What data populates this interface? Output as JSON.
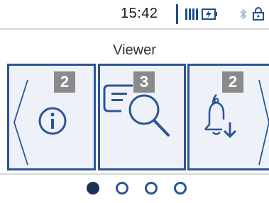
{
  "status_bar": {
    "time": "15:42",
    "icons": [
      "signal-bars-icon",
      "battery-charging-icon",
      "bluetooth-icon",
      "lock-icon"
    ]
  },
  "screen": {
    "title": "Viewer"
  },
  "carousel": {
    "panels": [
      {
        "badge": "2",
        "icon": "info-icon"
      },
      {
        "badge": "3",
        "icon": "document-search-icon"
      },
      {
        "badge": "2",
        "icon": "bell-download-icon"
      }
    ],
    "pager": {
      "total": 4,
      "active_index": 0
    }
  },
  "colors": {
    "accent": "#2c5596",
    "dark_accent": "#1c3158",
    "badge": "#8a8a8a",
    "panel_bg": "#eef2f8"
  }
}
